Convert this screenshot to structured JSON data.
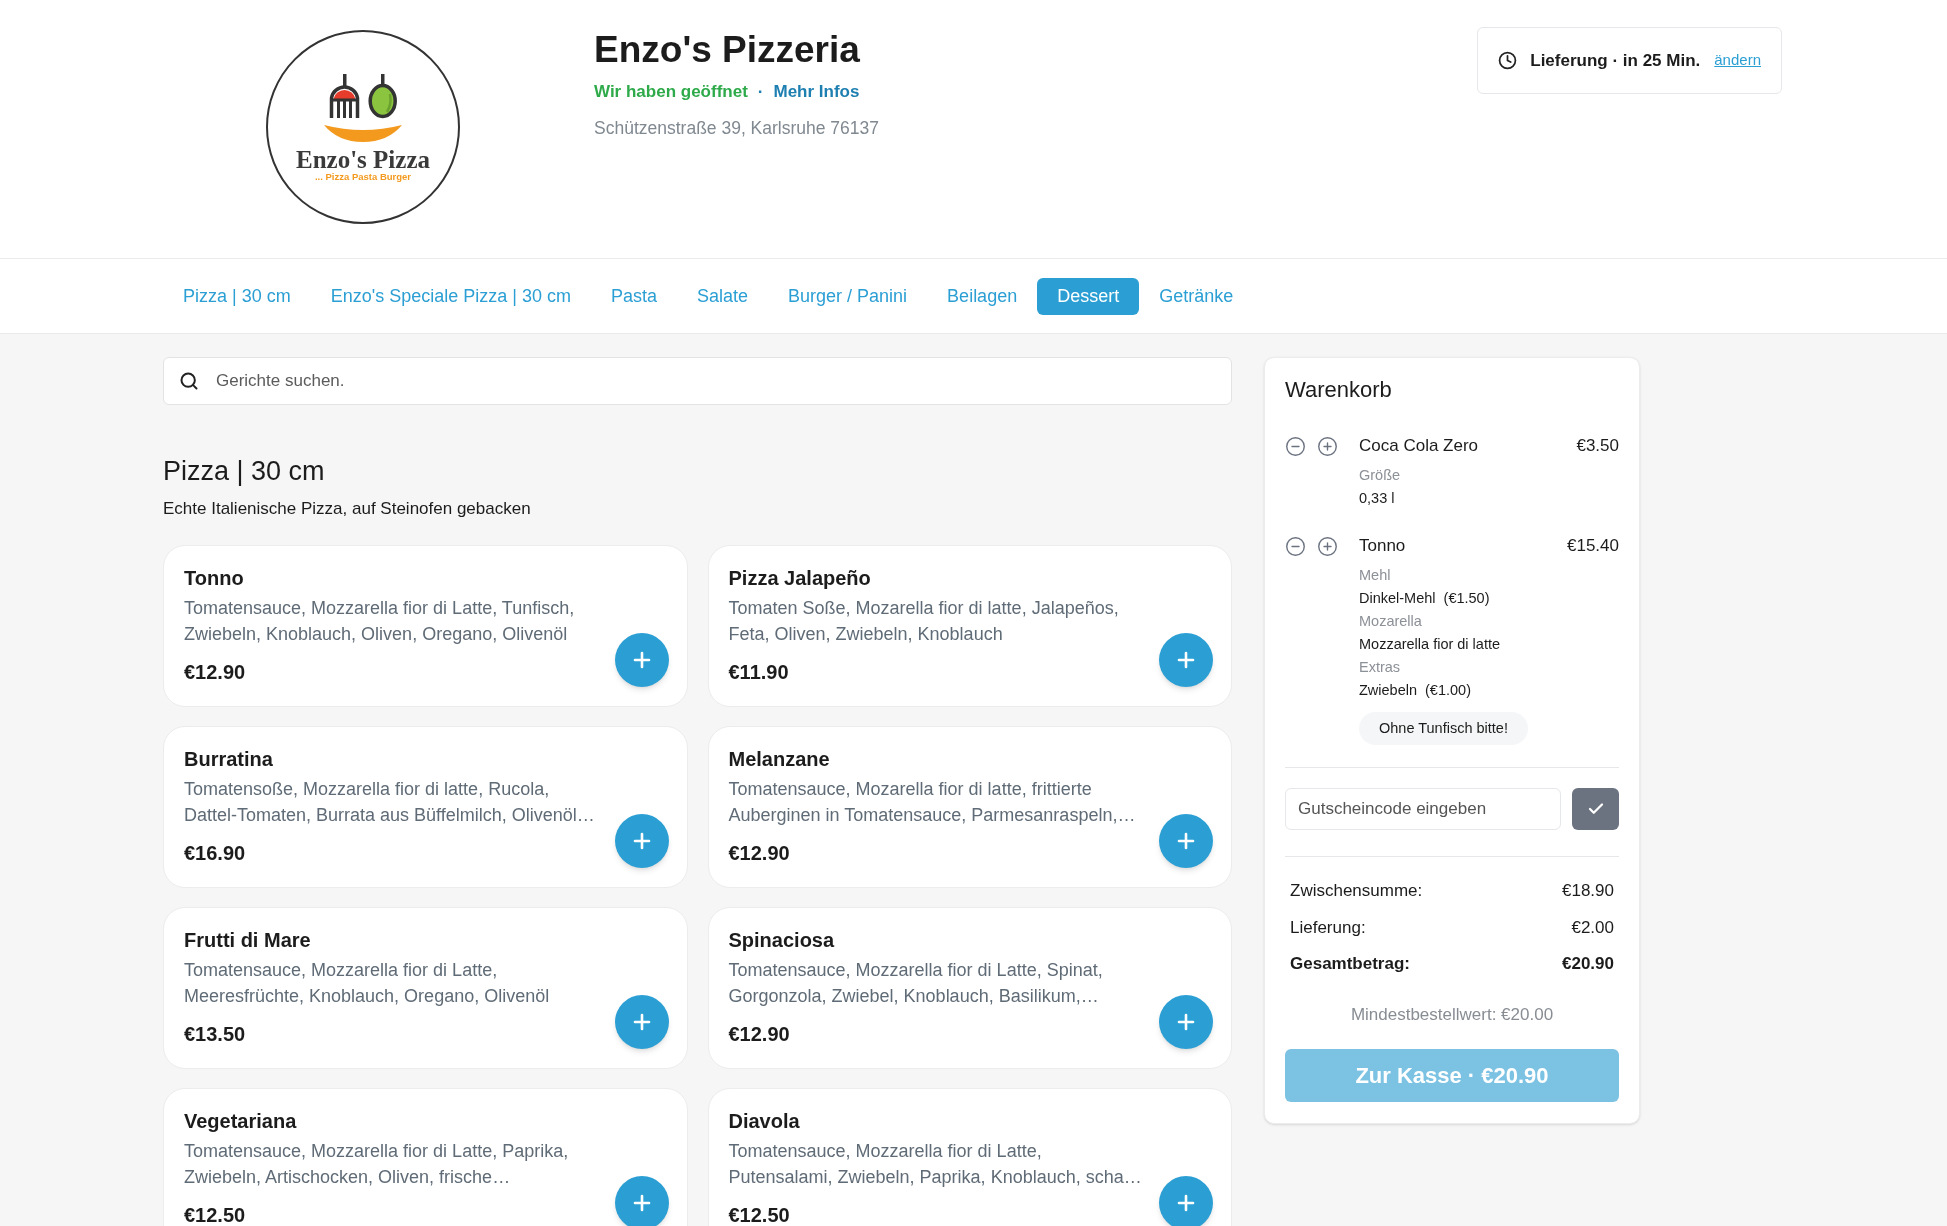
{
  "header": {
    "logo": {
      "name": "Enzo's Pizza",
      "tagline": "... Pizza Pasta Burger"
    },
    "title": "Enzo's Pizzeria",
    "status": "Wir haben geöffnet",
    "separator": "·",
    "info_link": "Mehr Infos",
    "address": "Schützenstraße 39, Karlsruhe 76137"
  },
  "delivery": {
    "text": "Lieferung · in 25 Min.",
    "link": "ändern"
  },
  "tabs": [
    {
      "label": "Pizza | 30 cm",
      "selected": false
    },
    {
      "label": "Enzo's Speciale Pizza | 30 cm",
      "selected": false
    },
    {
      "label": "Pasta",
      "selected": false
    },
    {
      "label": "Salate",
      "selected": false
    },
    {
      "label": "Burger / Panini",
      "selected": false
    },
    {
      "label": "Beilagen",
      "selected": false
    },
    {
      "label": "Dessert",
      "selected": true
    },
    {
      "label": "Getränke",
      "selected": false
    }
  ],
  "search": {
    "placeholder": "Gerichte suchen."
  },
  "section": {
    "title": "Pizza | 30 cm",
    "subtitle": "Echte Italienische Pizza, auf Steinofen gebacken"
  },
  "dishes": [
    {
      "name": "Tonno",
      "description": "Tomatensauce, Mozzarella fior di Latte, Tunfisch, Zwiebeln, Knoblauch, Oliven, Oregano, Olivenöl",
      "price": "€12.90"
    },
    {
      "name": "Pizza Jalapeño",
      "description": "Tomaten Soße, Mozarella fior di latte, Jalapeños, Feta, Oliven, Zwiebeln, Knoblauch",
      "price": "€11.90"
    },
    {
      "name": "Burratina",
      "description": "Tomatensoße, Mozzarella fior di latte, Rucola, Dattel-Tomaten, Burrata aus Büffelmilch, Olivenöl…",
      "price": "€16.90"
    },
    {
      "name": "Melanzane",
      "description": "Tomatensauce, Mozarella fior di latte, frittierte Auberginen in Tomatensauce, Parmesanraspeln,…",
      "price": "€12.90"
    },
    {
      "name": "Frutti di Mare",
      "description": "Tomatensauce, Mozzarella fior di Latte, Meeresfrüchte, Knoblauch, Oregano, Olivenöl",
      "price": "€13.50"
    },
    {
      "name": "Spinaciosa",
      "description": "Tomatensauce, Mozzarella fior di Latte, Spinat, Gorgonzola, Zwiebel, Knoblauch, Basilikum,…",
      "price": "€12.90"
    },
    {
      "name": "Vegetariana",
      "description": "Tomatensauce, Mozzarella fior di Latte, Paprika, Zwiebeln, Artischocken, Oliven, frische…",
      "price": "€12.50"
    },
    {
      "name": "Diavola",
      "description": "Tomatensauce, Mozzarella fior di Latte, Putensalami, Zwiebeln, Paprika, Knoblauch, scha…",
      "price": "€12.50"
    }
  ],
  "cart": {
    "title": "Warenkorb",
    "items": [
      {
        "name": "Coca Cola Zero",
        "price": "€3.50",
        "options": [
          {
            "label": "Größe",
            "value": "0,33 l"
          }
        ]
      },
      {
        "name": "Tonno",
        "price": "€15.40",
        "options": [
          {
            "label": "Mehl",
            "value": "Dinkel-Mehl",
            "surcharge": "(€1.50)"
          },
          {
            "label": "Mozarella",
            "value": "Mozzarella fior di latte"
          },
          {
            "label": "Extras",
            "value": "Zwiebeln",
            "surcharge": "(€1.00)"
          }
        ],
        "note": "Ohne Tunfisch bitte!"
      }
    ],
    "coupon": {
      "placeholder": "Gutscheincode eingeben"
    },
    "totals": [
      {
        "label": "Zwischensumme:",
        "value": "€18.90",
        "kind": "regular"
      },
      {
        "label": "Lieferung:",
        "value": "€2.00",
        "kind": "regular"
      },
      {
        "label": "Gesamtbetrag:",
        "value": "€20.90",
        "kind": "total"
      }
    ],
    "minimum": "Mindestbestellwert: €20.00",
    "checkout": "Zur Kasse · €20.90"
  }
}
